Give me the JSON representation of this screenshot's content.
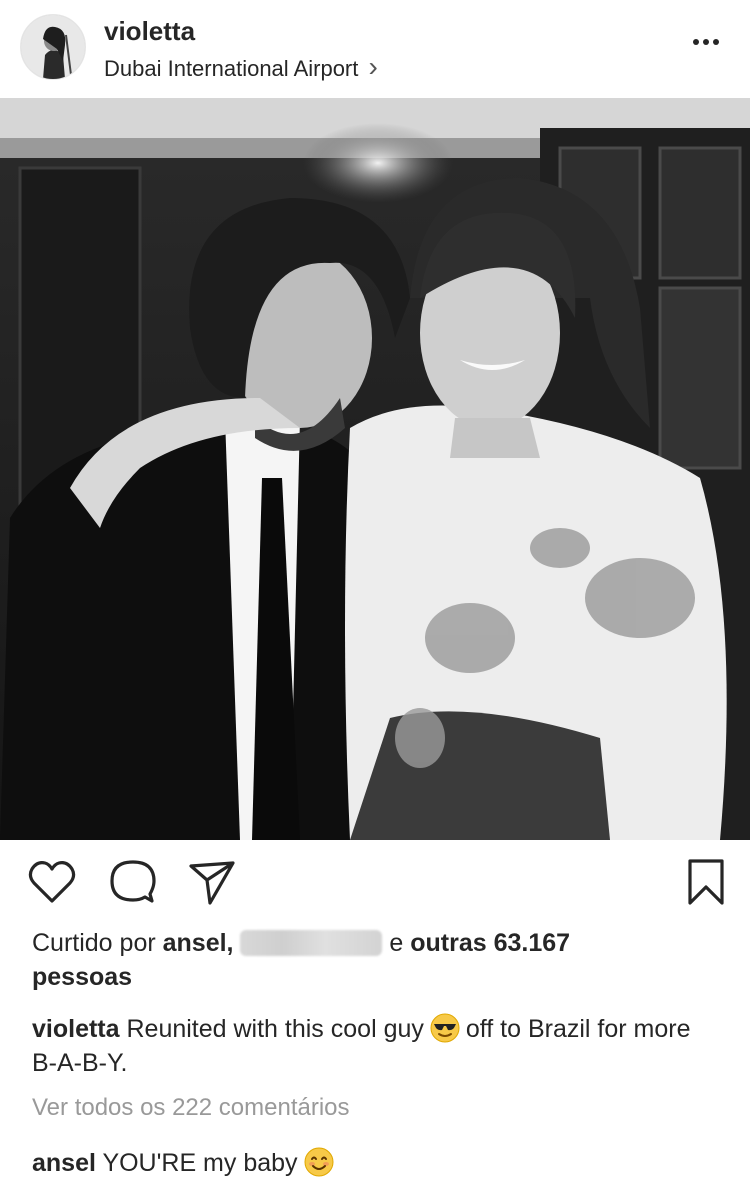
{
  "post": {
    "username": "violetta",
    "location": "Dubai International Airport",
    "location_chevron": "›"
  },
  "likes": {
    "prefix": "Curtido por ",
    "first_liker": "ansel,",
    "connector": " e ",
    "others": "outras 63.167",
    "suffix": "pessoas"
  },
  "caption": {
    "username": "violetta",
    "text_before_emoji": "Reunited with this cool guy",
    "emoji_icon": "sunglasses-face-emoji",
    "text_after_emoji": "off to Brazil for more B-A-B-Y."
  },
  "view_all_comments": "Ver todos os 222 comentários",
  "comment": {
    "username": "ansel",
    "text": "YOU'RE my baby",
    "emoji_icon": "smiling-face-emoji"
  },
  "icons": [
    "more-options-icon",
    "heart-icon",
    "comment-icon",
    "share-icon",
    "bookmark-icon"
  ]
}
